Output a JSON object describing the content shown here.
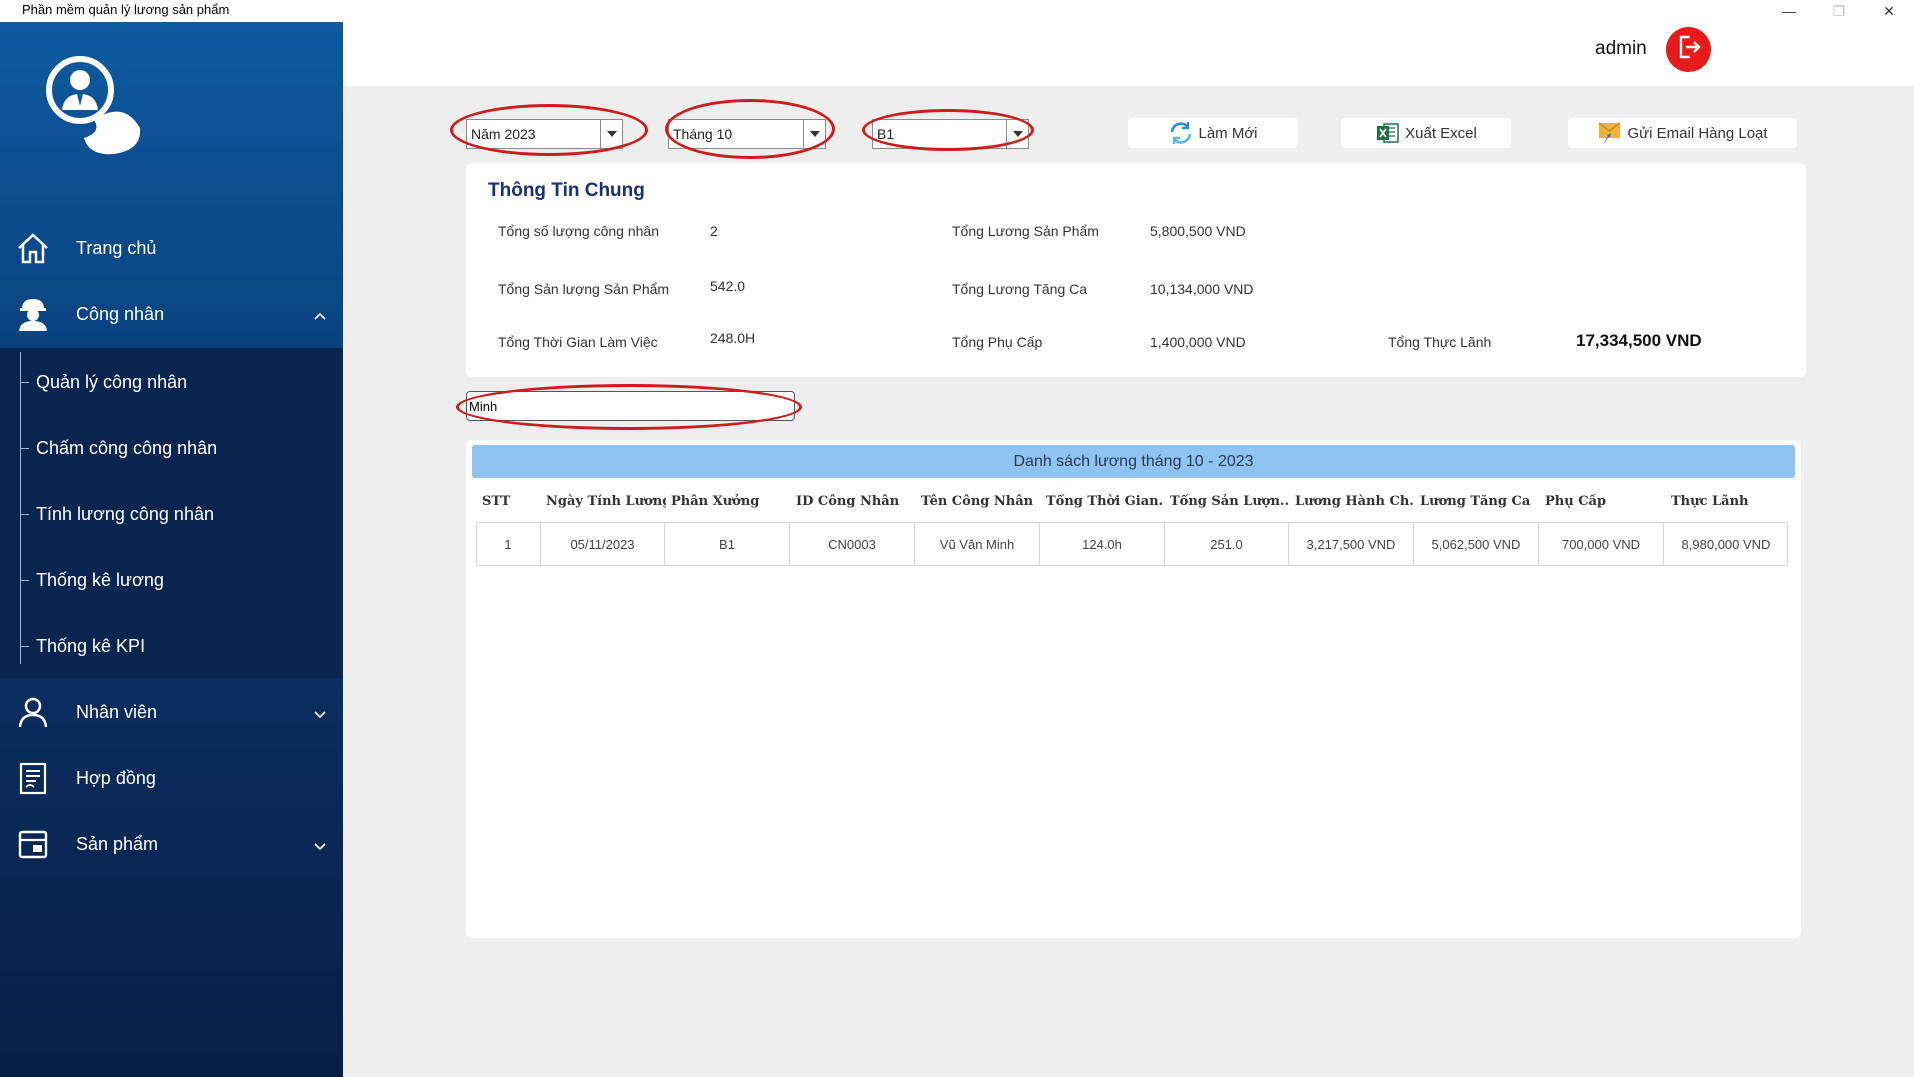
{
  "window": {
    "title": "Phần mềm quản lý lương sản phẩm",
    "minimize": "—",
    "restore": "❐",
    "close": "✕"
  },
  "header": {
    "user": "admin"
  },
  "sidebar": {
    "items": [
      {
        "label": "Trang chủ",
        "icon": "home-icon"
      },
      {
        "label": "Công nhân",
        "icon": "worker-icon",
        "expanded": true
      },
      {
        "label": "Nhân viên",
        "icon": "person-icon"
      },
      {
        "label": "Hợp đồng",
        "icon": "contract-icon"
      },
      {
        "label": "Sản phẩm",
        "icon": "product-icon"
      }
    ],
    "subitems": [
      {
        "label": "Quản lý công nhân"
      },
      {
        "label": "Chấm công công nhân"
      },
      {
        "label": "Tính lương công nhân"
      },
      {
        "label": "Thống kê lương"
      },
      {
        "label": "Thống kê KPI"
      }
    ]
  },
  "filters": {
    "year": "Năm 2023",
    "month": "Tháng 10",
    "workshop": "B1"
  },
  "toolbar": {
    "refresh": "Làm Mới",
    "export": "Xuất Excel",
    "email": "Gửi Email Hàng Loạt"
  },
  "info": {
    "title": "Thông Tin Chung",
    "total_workers_label": "Tổng số lượng công nhân",
    "total_workers": "2",
    "total_output_label": "Tổng Sản lượng Sản Phẩm",
    "total_output": "542.0",
    "total_hours_label": "Tổng Thời Gian Làm Việc",
    "total_hours": "248.0H",
    "product_salary_label": "Tổng Lương Sản Phẩm",
    "product_salary": "5,800,500 VND",
    "overtime_salary_label": "Tổng Lương Tăng Ca",
    "overtime_salary": "10,134,000 VND",
    "allowance_label": "Tổng Phụ Cấp",
    "allowance": "1,400,000 VND",
    "net_label": "Tổng Thực Lãnh",
    "net": "17,334,500 VND"
  },
  "search": {
    "value": "Minh"
  },
  "table": {
    "banner": "Danh sách lương tháng 10 - 2023",
    "columns": [
      "STT",
      "Ngày Tính Lương",
      "Phân Xưởng",
      "ID Công Nhân",
      "Tên Công Nhân",
      "Tổng Thời Gian...",
      "Tổng Sản Lượn...",
      "Lương Hành Ch...",
      "Lương Tăng Ca",
      "Phụ Cấp",
      "Thực Lãnh"
    ],
    "rows": [
      [
        "1",
        "05/11/2023",
        "B1",
        "CN0003",
        "Vũ Văn Minh",
        "124.0h",
        "251.0",
        "3,217,500 VND",
        "5,062,500 VND",
        "700,000 VND",
        "8,980,000 VND"
      ]
    ]
  },
  "colors": {
    "sidebar_top": "#0d5aa0",
    "sidebar_bottom": "#081f48",
    "banner": "#8fc4f0",
    "logout": "#e81b1b",
    "annotation": "#d11a1a"
  }
}
